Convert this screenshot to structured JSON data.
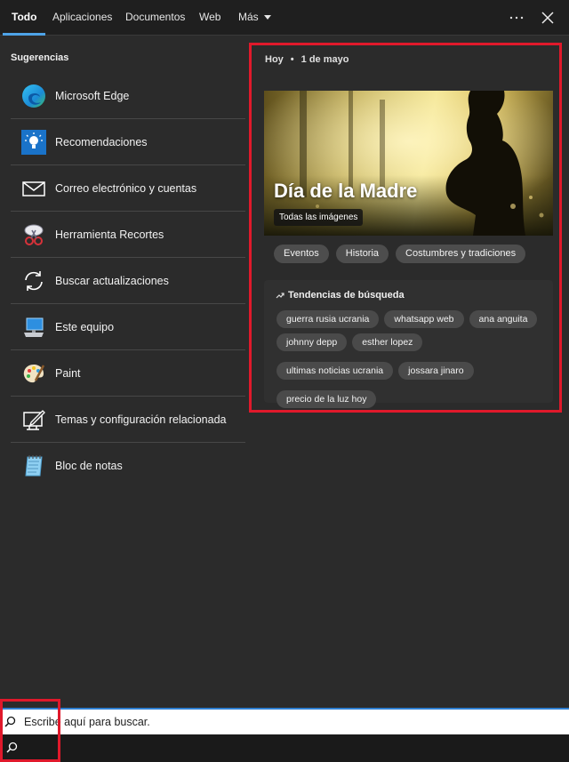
{
  "nav": {
    "tabs": [
      "Todo",
      "Aplicaciones",
      "Documentos",
      "Web",
      "Más"
    ],
    "active_tab": "Todo",
    "more_icon": "ellipsis-icon",
    "close_icon": "close-icon"
  },
  "suggestions": {
    "title": "Sugerencias",
    "items": [
      {
        "label": "Microsoft Edge",
        "icon": "edge-icon"
      },
      {
        "label": "Recomendaciones",
        "icon": "lightbulb-icon"
      },
      {
        "label": "Correo electrónico y cuentas",
        "icon": "mail-icon"
      },
      {
        "label": "Herramienta Recortes",
        "icon": "snipping-tool-icon"
      },
      {
        "label": "Buscar actualizaciones",
        "icon": "refresh-icon"
      },
      {
        "label": "Este equipo",
        "icon": "computer-icon"
      },
      {
        "label": "Paint",
        "icon": "paint-palette-icon"
      },
      {
        "label": "Temas y configuración relacionada",
        "icon": "theme-edit-icon"
      },
      {
        "label": "Bloc de notas",
        "icon": "notepad-icon"
      }
    ]
  },
  "today": {
    "label": "Hoy",
    "date": "1 de mayo",
    "hero_title": "Día de la Madre",
    "hero_button": "Todas las imágenes",
    "chips": [
      "Eventos",
      "Historia",
      "Costumbres y tradiciones"
    ]
  },
  "trends": {
    "title": "Tendencias de búsqueda",
    "items": [
      "guerra rusia ucrania",
      "whatsapp web",
      "ana anguita",
      "johnny depp",
      "esther lopez",
      "ultimas noticias ucrania",
      "jossara jinaro",
      "precio de la luz hoy"
    ]
  },
  "search": {
    "placeholder": "Escribe aquí para buscar."
  },
  "colors": {
    "accent": "#4ea3e8",
    "highlight_border": "#e0192b",
    "background": "#2b2b2b"
  }
}
